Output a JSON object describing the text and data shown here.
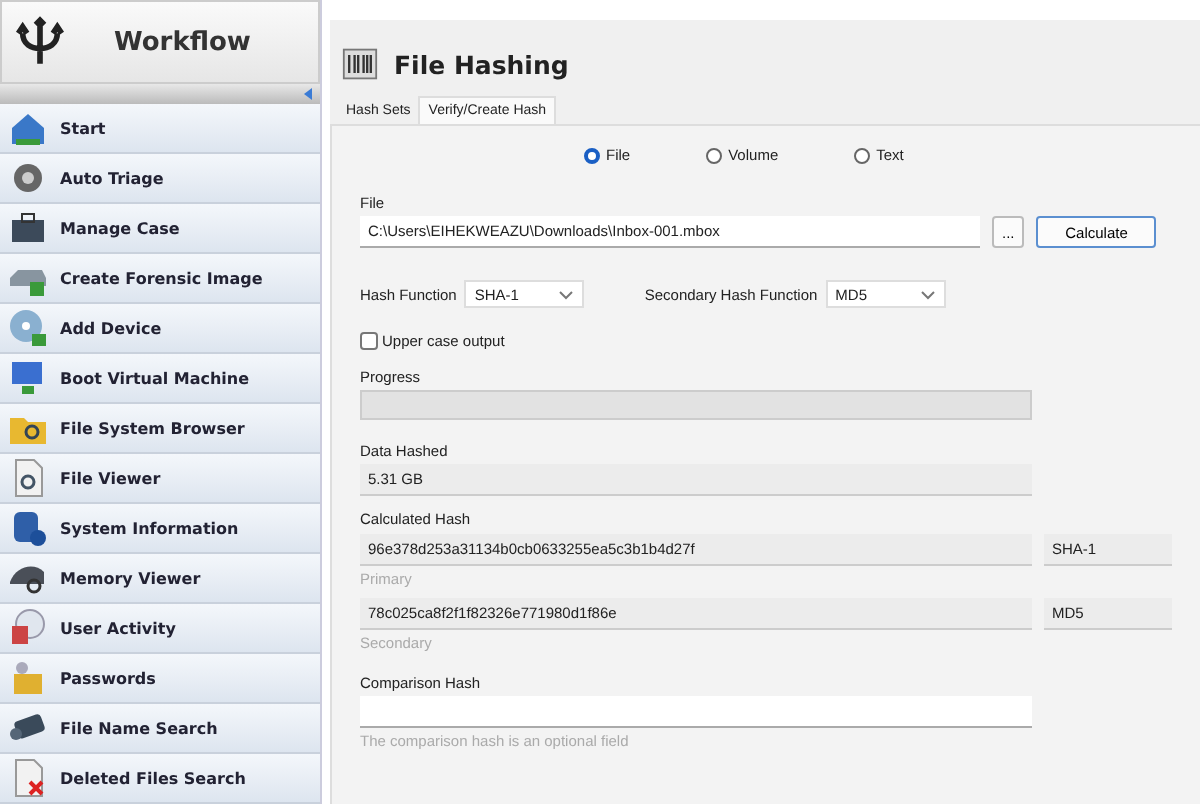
{
  "sidebar": {
    "title": "Workflow",
    "items": [
      {
        "label": "Start"
      },
      {
        "label": "Auto Triage"
      },
      {
        "label": "Manage Case"
      },
      {
        "label": "Create Forensic Image"
      },
      {
        "label": "Add Device"
      },
      {
        "label": "Boot Virtual Machine"
      },
      {
        "label": "File System Browser"
      },
      {
        "label": "File Viewer"
      },
      {
        "label": "System Information"
      },
      {
        "label": "Memory Viewer"
      },
      {
        "label": "User Activity"
      },
      {
        "label": "Passwords"
      },
      {
        "label": "File Name Search"
      },
      {
        "label": "Deleted Files Search"
      }
    ]
  },
  "panel": {
    "title": "File Hashing",
    "tabs": [
      {
        "label": "Hash Sets",
        "selected": false
      },
      {
        "label": "Verify/Create Hash",
        "selected": true
      }
    ],
    "source_options": [
      {
        "label": "File",
        "selected": true
      },
      {
        "label": "Volume",
        "selected": false
      },
      {
        "label": "Text",
        "selected": false
      }
    ],
    "file": {
      "label": "File",
      "value": "C:\\Users\\EIHEKWEAZU\\Downloads\\Inbox-001.mbox",
      "browse_button": "...",
      "calculate_button": "Calculate"
    },
    "hash_function": {
      "label": "Hash Function",
      "value": "SHA-1"
    },
    "secondary_hash_function": {
      "label": "Secondary Hash Function",
      "value": "MD5"
    },
    "upper_case_output": {
      "label": "Upper case output",
      "checked": false
    },
    "progress": {
      "label": "Progress",
      "level": 0
    },
    "data_hashed": {
      "label": "Data Hashed",
      "value": "5.31 GB"
    },
    "calculated_hash": {
      "label": "Calculated Hash",
      "results": [
        {
          "value": "96e378d253a31134b0cb0633255ea5c3b1b4d27f",
          "algorithm": "SHA-1",
          "caption": "Primary"
        },
        {
          "value": "78c025ca8f2f1f82326e771980d1f86e",
          "algorithm": "MD5",
          "caption": "Secondary"
        }
      ]
    },
    "comparison_hash": {
      "label": "Comparison Hash",
      "hint": "The comparison hash is an optional field"
    }
  }
}
